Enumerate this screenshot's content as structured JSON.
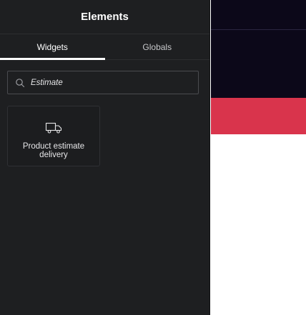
{
  "panel": {
    "title": "Elements",
    "tabs": [
      {
        "label": "Widgets",
        "active": true
      },
      {
        "label": "Globals",
        "active": false
      }
    ],
    "search": {
      "value": "Estimate",
      "icon": "search-icon"
    },
    "widgets": [
      {
        "label": "Product estimate delivery",
        "icon": "truck-icon"
      }
    ]
  },
  "colors": {
    "panel_bg": "#1e1f21",
    "canvas_dark": "#0c0819",
    "canvas_accent": "#d9344c",
    "canvas_light": "#ffffff"
  }
}
